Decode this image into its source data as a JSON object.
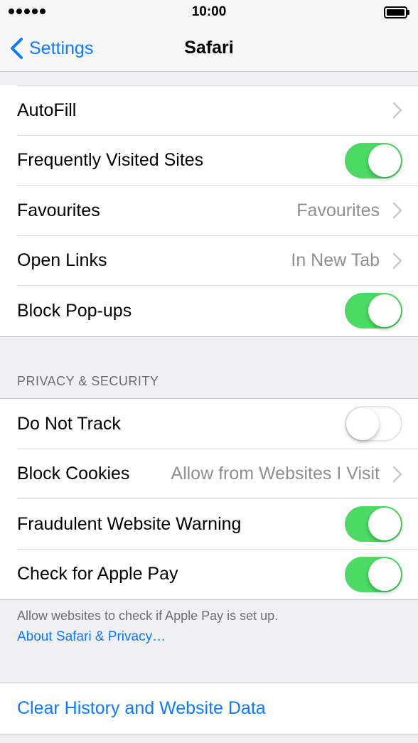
{
  "status_bar": {
    "time": "10:00"
  },
  "nav": {
    "back_label": "Settings",
    "title": "Safari"
  },
  "general": [
    {
      "label": "AutoFill",
      "value": "",
      "accessory": "chevron"
    },
    {
      "label": "Frequently Visited Sites",
      "accessory": "toggle",
      "on": true
    },
    {
      "label": "Favourites",
      "value": "Favourites",
      "accessory": "chevron"
    },
    {
      "label": "Open Links",
      "value": "In New Tab",
      "accessory": "chevron"
    },
    {
      "label": "Block Pop-ups",
      "accessory": "toggle",
      "on": true
    }
  ],
  "privacy": {
    "header": "PRIVACY & SECURITY",
    "rows": [
      {
        "label": "Do Not Track",
        "accessory": "toggle",
        "on": false
      },
      {
        "label": "Block Cookies",
        "value": "Allow from Websites I Visit",
        "accessory": "chevron"
      },
      {
        "label": "Fraudulent Website Warning",
        "accessory": "toggle",
        "on": true
      },
      {
        "label": "Check for Apple Pay",
        "accessory": "toggle",
        "on": true
      }
    ],
    "footer_text": "Allow websites to check if Apple Pay is set up.",
    "footer_link": "About Safari & Privacy…"
  },
  "actions": {
    "clear_history": "Clear History and Website Data"
  },
  "colors": {
    "accent": "#0e7aff",
    "toggle_on": "#4cd964",
    "background": "#efeff4"
  }
}
